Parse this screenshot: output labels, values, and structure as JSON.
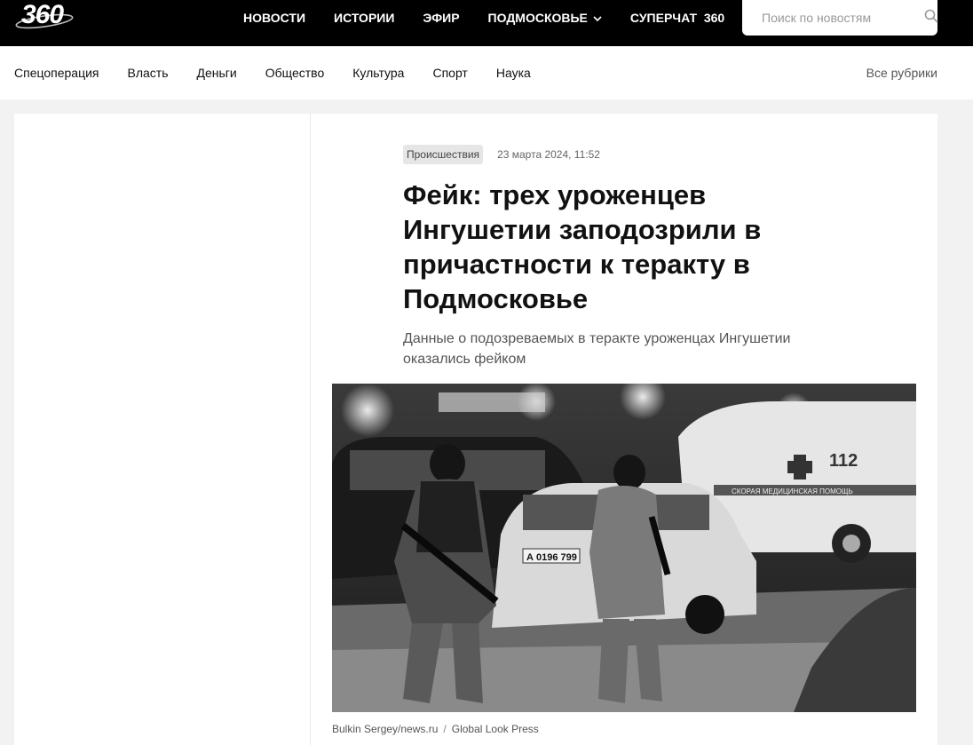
{
  "header": {
    "logo_text": "360",
    "nav": [
      {
        "label": "НОВОСТИ"
      },
      {
        "label": "ИСТОРИИ"
      },
      {
        "label": "ЭФИР"
      },
      {
        "label": "ПОДМОСКОВЬЕ"
      },
      {
        "label": "СУПЕРЧАТ  360"
      }
    ],
    "search_placeholder": "Поиск по новостям"
  },
  "rubrics": {
    "items": [
      "Спецоперация",
      "Власть",
      "Деньги",
      "Общество",
      "Культура",
      "Спорт",
      "Наука"
    ],
    "all_label": "Все рубрики"
  },
  "article": {
    "tag": "Происшествия",
    "date": "23 марта 2024, 11:52",
    "title": "Фейк: трех уроженцев Ингушетии заподозрили в причастности к теракту в Подмосковье",
    "lead": "Данные о подозреваемых в теракте уроженцах Ингушетии оказались фейком",
    "photo_text": {
      "plate": "А 0196 799",
      "ambulance": "112",
      "ambulance_small": "СКОРАЯ  МЕДИЦИНСКАЯ  ПОМОЩЬ"
    },
    "caption_author": "Bulkin Sergey/news.ru",
    "caption_sep": "/",
    "caption_agency": "Global Look Press"
  },
  "icons": {
    "search": "search-icon",
    "chevron": "chevron-down-icon"
  },
  "colors": {
    "topbar": "#000000",
    "page_bg": "#f2f2f2",
    "tag_bg": "#e6e6e6"
  }
}
